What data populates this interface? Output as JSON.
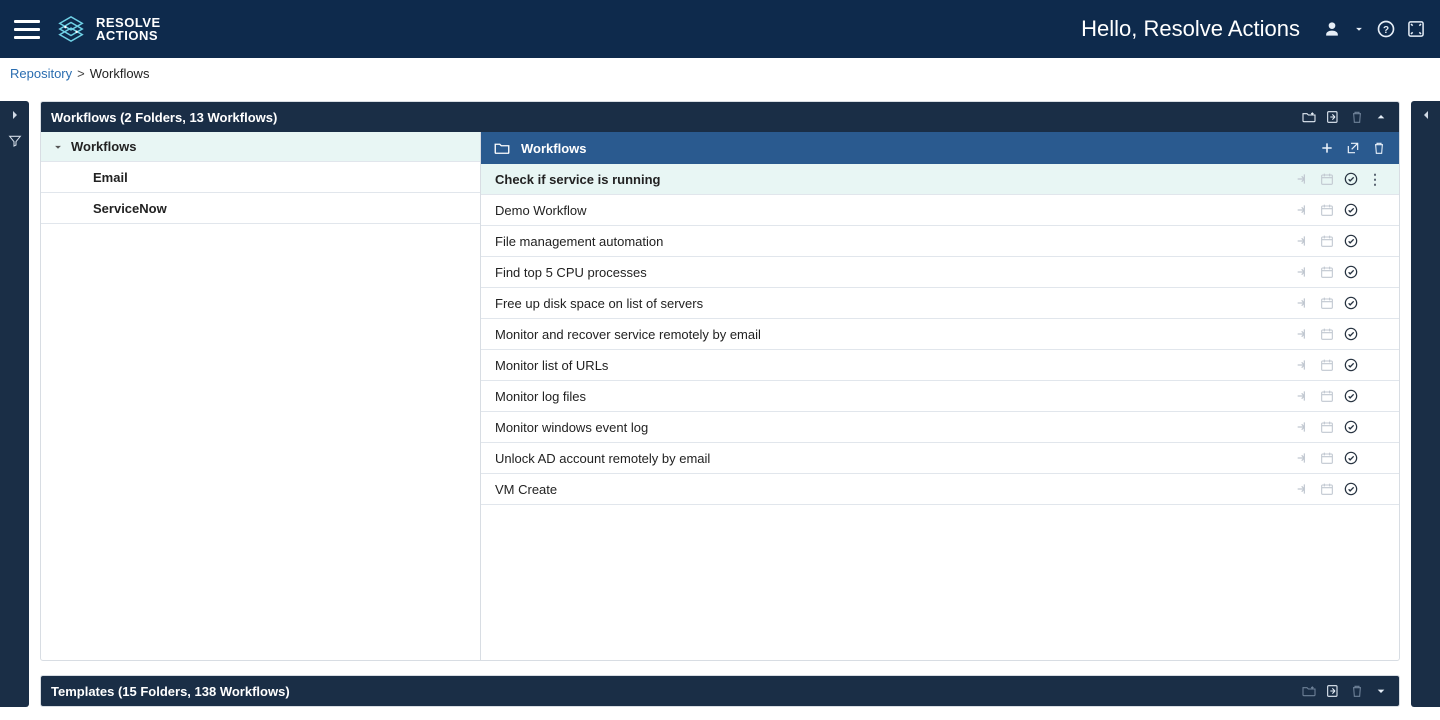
{
  "app": {
    "brand1": "RESOLVE",
    "brand2": "ACTIONS",
    "hello": "Hello, Resolve Actions"
  },
  "breadcrumb": {
    "root": "Repository",
    "current": "Workflows"
  },
  "workflowsPanel": {
    "title": "Workflows (2 Folders, 13 Workflows)",
    "treeRoot": "Workflows",
    "folders": [
      "Email",
      "ServiceNow"
    ],
    "listTitle": "Workflows",
    "rows": [
      "Check if service is running",
      "Demo Workflow",
      "File management automation",
      "Find top 5 CPU processes",
      "Free up disk space on list of servers",
      "Monitor and recover service remotely by email",
      "Monitor list of URLs",
      "Monitor log files",
      "Monitor windows event log",
      "Unlock AD account remotely by email",
      "VM Create"
    ],
    "selectedIndex": 0
  },
  "templatesPanel": {
    "title": "Templates (15 Folders, 138 Workflows)"
  }
}
